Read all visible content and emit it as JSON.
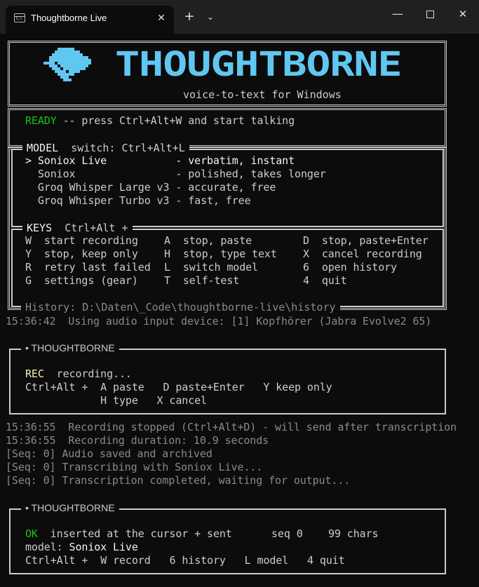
{
  "window": {
    "tab_title": "Thoughtborne Live",
    "tab_close": "✕",
    "new_tab": "+",
    "dropdown": "⌄",
    "minimize": "—",
    "close": "✕"
  },
  "banner": {
    "title": "THOUGHTBORNE",
    "subtitle": "voice-to-text for Windows"
  },
  "status": {
    "state": "READY",
    "message": " -- press Ctrl+Alt+W and start talking"
  },
  "model_section": {
    "title": "MODEL",
    "switch": "switch: Ctrl+Alt+L",
    "items": [
      {
        "marker": "> ",
        "name": "Soniox Live          ",
        "desc": " - verbatim, instant"
      },
      {
        "marker": "  ",
        "name": "Soniox               ",
        "desc": " - polished, takes longer"
      },
      {
        "marker": "  ",
        "name": "Groq Whisper Large v3",
        "desc": " - accurate, free"
      },
      {
        "marker": "  ",
        "name": "Groq Whisper Turbo v3",
        "desc": " - fast, free"
      }
    ]
  },
  "keys_section": {
    "title": "KEYS",
    "modifier": "Ctrl+Alt +",
    "rows": [
      [
        {
          "key": "W",
          "action": "start recording"
        },
        {
          "key": "A",
          "action": "stop, paste"
        },
        {
          "key": "D",
          "action": "stop, paste+Enter"
        }
      ],
      [
        {
          "key": "Y",
          "action": "stop, keep only"
        },
        {
          "key": "H",
          "action": "stop, type text"
        },
        {
          "key": "X",
          "action": "cancel recording"
        }
      ],
      [
        {
          "key": "R",
          "action": "retry last failed"
        },
        {
          "key": "L",
          "action": "switch model"
        },
        {
          "key": "6",
          "action": "open history"
        }
      ],
      [
        {
          "key": "G",
          "action": "settings (gear)"
        },
        {
          "key": "T",
          "action": "self-test"
        },
        {
          "key": "4",
          "action": "quit"
        }
      ]
    ]
  },
  "history_line": "History: D:\\Daten\\_Code\\thoughtborne-live\\history",
  "log1": "15:36:42  Using audio input device: [1] Kopfhörer (Jabra Evolve2 65)",
  "rec_panel": {
    "title": "• THOUGHTBORNE",
    "state": "REC",
    "message": "recording...",
    "line2": "Ctrl+Alt +  A paste   D paste+Enter   Y keep only",
    "line3": "            H type   X cancel"
  },
  "log2": [
    "15:36:55  Recording stopped (Ctrl+Alt+D) - will send after transcription",
    "15:36:55  Recording duration: 10.9 seconds",
    "[Seq: 0] Audio saved and archived",
    "[Seq: 0] Transcribing with Soniox Live...",
    "[Seq: 0] Transcription completed, waiting for output..."
  ],
  "ok_panel": {
    "title": "• THOUGHTBORNE",
    "state": "OK",
    "message": "inserted at the cursor + sent",
    "seq": "seq 0",
    "chars": "99 chars",
    "model_label": "model:",
    "model_value": "Soniox Live",
    "modifier": "Ctrl+Alt +",
    "shortcuts": [
      {
        "key": "W",
        "action": "record"
      },
      {
        "key": "6",
        "action": "history"
      },
      {
        "key": "L",
        "action": "model"
      },
      {
        "key": "4",
        "action": "quit"
      }
    ]
  },
  "colors": {
    "background": "#0c0c0c",
    "titlebar": "#202020",
    "banner": "#5fc7f0",
    "ready": "#16c60c",
    "rec": "#f9f1a5",
    "dim": "#8a8a8a"
  }
}
